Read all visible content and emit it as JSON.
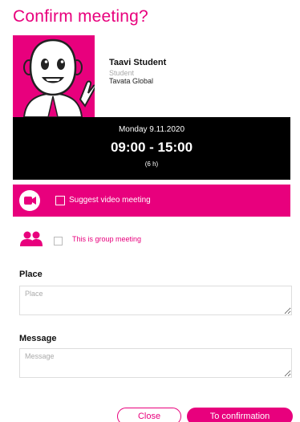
{
  "dialog": {
    "title": "Confirm meeting?"
  },
  "profile": {
    "name": "Taavi Student",
    "role": "Student",
    "organization": "Tavata Global"
  },
  "time": {
    "date": "Monday 9.11.2020",
    "range": "09:00 - 15:00",
    "duration": "(6 h)"
  },
  "video": {
    "label": "Suggest video meeting",
    "checked": false
  },
  "group": {
    "label": "This is group meeting",
    "checked": false
  },
  "place": {
    "label": "Place",
    "placeholder": "Place",
    "value": ""
  },
  "message": {
    "label": "Message",
    "placeholder": "Message",
    "value": ""
  },
  "actions": {
    "close_label": "Close",
    "confirm_label": "To confirmation"
  },
  "colors": {
    "accent": "#e8007d",
    "time_bg": "#000000"
  },
  "icons": {
    "avatar": "cartoon-student-avatar",
    "video": "video-camera-icon",
    "group": "group-people-icon"
  }
}
